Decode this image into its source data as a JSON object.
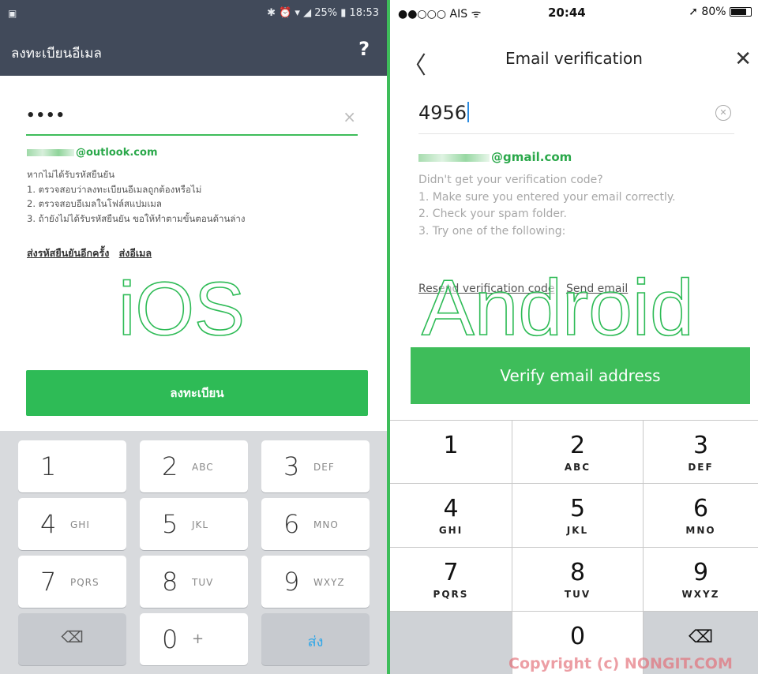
{
  "left_panel": {
    "status": {
      "icons": "✱ ⏰ ▾ ◢ 25% ▮",
      "time": "18:53",
      "notification_icon": "sim-icon"
    },
    "title": "ลงทะเบียนอีเมล",
    "help_label": "?",
    "code_value": "••••",
    "clear_label": "×",
    "email_domain": "@outlook.com",
    "info_lines": [
      "หากไม่ได้รับรหัสยืนยัน",
      "1. ตรวจสอบว่าลงทะเบียนอีเมลถูกต้องหรือไม่",
      "2. ตรวจสอบอีเมลในโฟล์สแปมเมล",
      "3. ถ้ายังไม่ได้รับรหัสยืนยัน ขอให้ทำตามขั้นตอนด้านล่าง"
    ],
    "links": [
      "ส่งรหัสยืนยันอีกครั้ง",
      "ส่งอีเมล"
    ],
    "overlay_label": "iOS",
    "submit_label": "ลงทะเบียน",
    "keypad": [
      {
        "n": "1",
        "s": ""
      },
      {
        "n": "2",
        "s": "ABC"
      },
      {
        "n": "3",
        "s": "DEF"
      },
      {
        "n": "4",
        "s": "GHI"
      },
      {
        "n": "5",
        "s": "JKL"
      },
      {
        "n": "6",
        "s": "MNO"
      },
      {
        "n": "7",
        "s": "PQRS"
      },
      {
        "n": "8",
        "s": "TUV"
      },
      {
        "n": "9",
        "s": "WXYZ"
      }
    ],
    "delete_label": "⌫",
    "zero_label": "0",
    "plus_label": "+",
    "send_label": "ส่ง"
  },
  "right_panel": {
    "status": {
      "carrier": "●●○○○ AIS ᯤ",
      "time": "20:44",
      "battery": "➚ 80%"
    },
    "back_label": "〈",
    "title": "Email verification",
    "close_label": "✕",
    "code_value": "4956",
    "clear_label": "✕",
    "email_domain": "@gmail.com",
    "info_lines": [
      "Didn't get your verification code?",
      "1. Make sure you entered your email correctly.",
      "2. Check your spam folder.",
      "3. Try one of the following:"
    ],
    "links": [
      "Resend verification code",
      "Send email"
    ],
    "overlay_label": "Android",
    "submit_label": "Verify email address",
    "keypad": [
      {
        "n": "1",
        "s": ""
      },
      {
        "n": "2",
        "s": "ABC"
      },
      {
        "n": "3",
        "s": "DEF"
      },
      {
        "n": "4",
        "s": "GHI"
      },
      {
        "n": "5",
        "s": "JKL"
      },
      {
        "n": "6",
        "s": "MNO"
      },
      {
        "n": "7",
        "s": "PQRS"
      },
      {
        "n": "8",
        "s": "TUV"
      },
      {
        "n": "9",
        "s": "WXYZ"
      }
    ],
    "zero_label": "0",
    "delete_label": "⌫"
  },
  "watermark": "Copyright (c) NONGIT.COM",
  "colors": {
    "line_green": "#2ebb56",
    "header_bg": "#414a5a",
    "link_blue": "#2ea6e8"
  }
}
